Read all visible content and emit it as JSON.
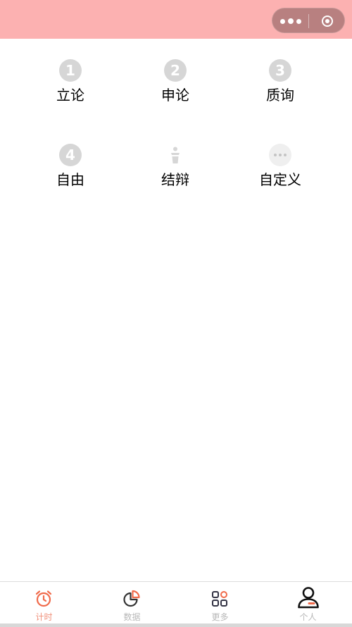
{
  "header": {
    "background": "#fcb1b1",
    "capsule": {
      "more_icon": "more-dots-icon",
      "close_icon": "target-circle-icon"
    }
  },
  "stages": [
    {
      "number": "1",
      "label": "立论",
      "icon": "number-1-icon"
    },
    {
      "number": "2",
      "label": "申论",
      "icon": "number-2-icon"
    },
    {
      "number": "3",
      "label": "质询",
      "icon": "number-3-icon"
    },
    {
      "number": "4",
      "label": "自由",
      "icon": "number-4-icon"
    },
    {
      "number": "",
      "label": "结辩",
      "icon": "microphone-icon"
    },
    {
      "number": "",
      "label": "自定义",
      "icon": "ellipsis-icon"
    }
  ],
  "tabbar": {
    "tabs": [
      {
        "label": "计时",
        "icon": "alarm-clock-icon",
        "active": true
      },
      {
        "label": "数据",
        "icon": "pie-chart-icon",
        "active": false
      },
      {
        "label": "更多",
        "icon": "grid-apps-icon",
        "active": false
      },
      {
        "label": "个人",
        "icon": "user-icon",
        "active": false
      }
    ]
  },
  "colors": {
    "accent": "#f0907a",
    "icon_gray": "#d6d6d6",
    "inactive_text": "#b8b8b8"
  }
}
